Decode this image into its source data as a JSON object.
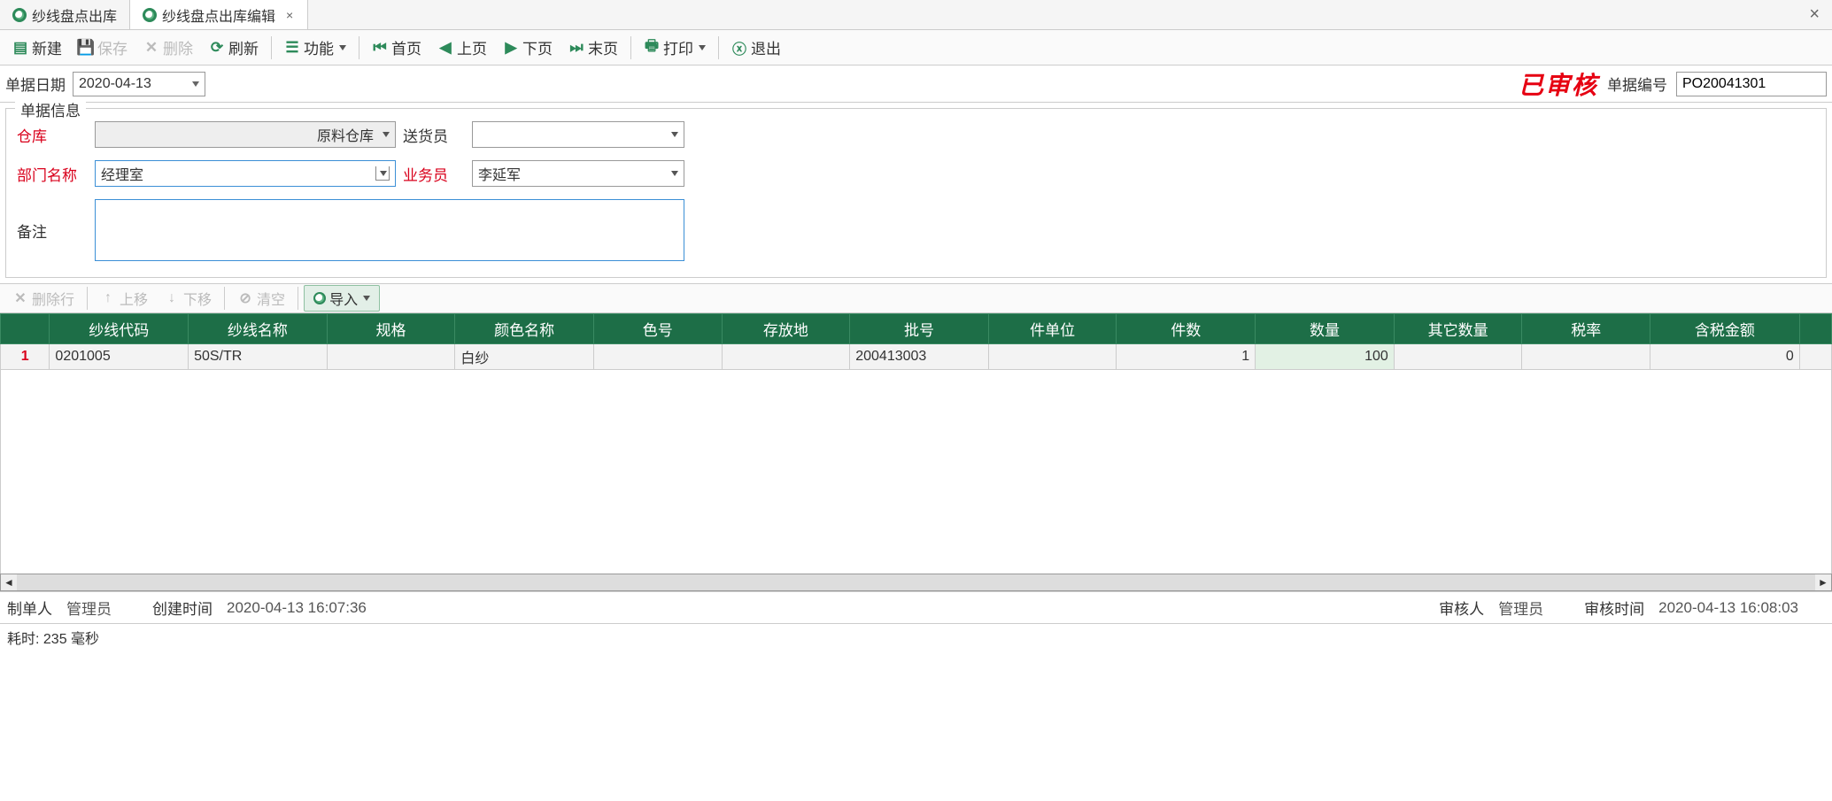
{
  "tabs": {
    "items": [
      {
        "label": "纱线盘点出库",
        "closable": false,
        "active": false
      },
      {
        "label": "纱线盘点出库编辑",
        "closable": true,
        "active": true
      }
    ]
  },
  "toolbar": {
    "new": "新建",
    "save": "保存",
    "delete": "删除",
    "refresh": "刷新",
    "function": "功能",
    "first": "首页",
    "prev": "上页",
    "next": "下页",
    "last": "末页",
    "print": "打印",
    "exit": "退出"
  },
  "header": {
    "date_label": "单据日期",
    "date_value": "2020-04-13",
    "stamp": "已审核",
    "docno_label": "单据编号",
    "docno_value": "PO20041301"
  },
  "form": {
    "legend": "单据信息",
    "warehouse_label": "仓库",
    "warehouse_value": "原料仓库",
    "deliverer_label": "送货员",
    "deliverer_value": "",
    "dept_label": "部门名称",
    "dept_value": "经理室",
    "salesman_label": "业务员",
    "salesman_value": "李延军",
    "remark_label": "备注",
    "remark_value": ""
  },
  "grid_toolbar": {
    "delrow": "删除行",
    "moveup": "上移",
    "movedown": "下移",
    "clear": "清空",
    "import": "导入"
  },
  "grid": {
    "columns": [
      "纱线代码",
      "纱线名称",
      "规格",
      "颜色名称",
      "色号",
      "存放地",
      "批号",
      "件单位",
      "件数",
      "数量",
      "其它数量",
      "税率",
      "含税金额"
    ],
    "rows": [
      {
        "rownum": "1",
        "yarn_code": "0201005",
        "yarn_name": "50S/TR",
        "spec": "",
        "color_name": "白纱",
        "color_no": "",
        "location": "",
        "batch": "200413003",
        "unit": "",
        "pieces": "1",
        "qty": "100",
        "other_qty": "",
        "tax_rate": "",
        "tax_amount": "0"
      }
    ]
  },
  "footer": {
    "creator_label": "制单人",
    "creator_value": "管理员",
    "create_time_label": "创建时间",
    "create_time_value": "2020-04-13 16:07:36",
    "auditor_label": "审核人",
    "auditor_value": "管理员",
    "audit_time_label": "审核时间",
    "audit_time_value": "2020-04-13 16:08:03"
  },
  "status": {
    "text": "耗时: 235 毫秒"
  }
}
